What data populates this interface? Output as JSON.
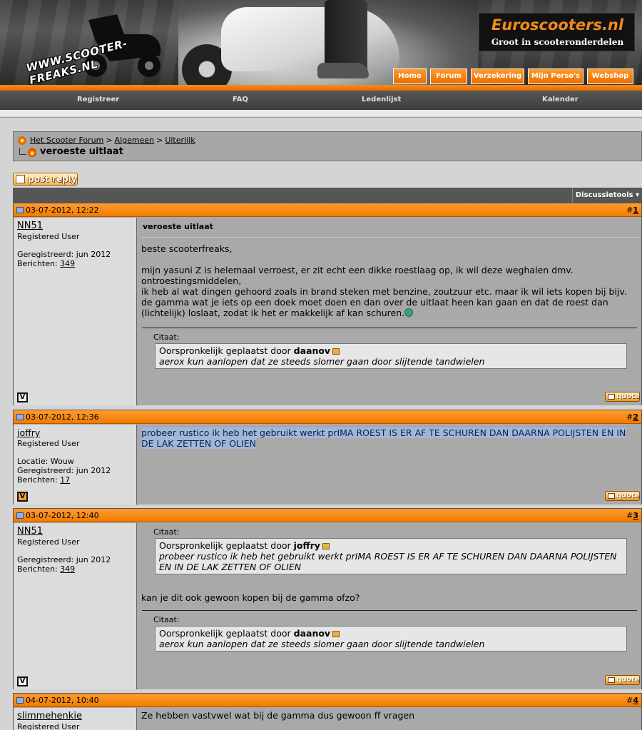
{
  "header": {
    "logo_text": "WWW.SCOOTER-FREAKS.NL",
    "sponsor_title": "Euroscooters.nl",
    "sponsor_subtitle": "Groot in scooteronderdelen",
    "nav": [
      "Home",
      "Forum",
      "Verzekering",
      "Mijn Perso's",
      "Webshop"
    ],
    "subnav": [
      "Registreer",
      "FAQ",
      "Ledenlijst",
      "Kalender"
    ]
  },
  "breadcrumb": {
    "items": [
      "Het Scooter Forum",
      "Algemeen",
      "Uiterlijk"
    ],
    "separator": ">",
    "title": "veroeste uitlaat"
  },
  "toolbar": {
    "post_reply_label": "post reply",
    "tools_label": "Discussietools"
  },
  "posts": [
    {
      "date": "03-07-2012, 12:22",
      "number": "1",
      "user": "NN51",
      "user_title": "Registered User",
      "registered": "Geregistreerd: jun 2012",
      "posts_label": "Berichten:",
      "posts_count": "349",
      "title": "veroeste uitlaat",
      "text": "beste scooterfreaks,\n\nmijn yasuni Z is helemaal verroest, er zit echt een dikke roestlaag op, ik wil deze weghalen dmv. ontroestingsmiddelen,\nik heb al wat dingen gehoord zoals in brand steken met benzine, zoutzuur etc. maar ik wil iets kopen bij bijv. de gamma wat je iets op een doek moet doen en dan over de uitlaat heen kan gaan en dat de roest dan (lichtelijk) loslaat, zodat ik het er makkelijk af kan schuren.",
      "quote_label": "Citaat:",
      "quote_by_prefix": "Oorspronkelijk geplaatst door",
      "quote_author": "daanov",
      "quote_text": "aerox kun aanlopen dat ze steeds slomer gaan door slijtende tandwielen",
      "quote_button": "quote"
    },
    {
      "date": "03-07-2012, 12:36",
      "number": "2",
      "user": "joffry",
      "user_title": "Registered User",
      "location": "Locatie: Wouw",
      "registered": "Geregistreerd: jun 2012",
      "posts_label": "Berichten:",
      "posts_count": "17",
      "text": "probeer rustico ik heb het gebruikt werkt prIMA ROEST IS ER AF TE SCHUREN DAN DAARNA POLIJSTEN EN IN DE LAK ZETTEN OF OLIEN",
      "quote_button": "quote"
    },
    {
      "date": "03-07-2012, 12:40",
      "number": "3",
      "user": "NN51",
      "user_title": "Registered User",
      "registered": "Geregistreerd: jun 2012",
      "posts_label": "Berichten:",
      "posts_count": "349",
      "quote1_label": "Citaat:",
      "quote1_by_prefix": "Oorspronkelijk geplaatst door",
      "quote1_author": "joffry",
      "quote1_text": "probeer rustico ik heb het gebruikt werkt prIMA ROEST IS ER AF TE SCHUREN DAN DAARNA POLIJSTEN EN IN DE LAK ZETTEN OF OLIEN",
      "text": "kan je dit ook gewoon kopen bij de gamma ofzo?",
      "quote2_label": "Citaat:",
      "quote2_by_prefix": "Oorspronkelijk geplaatst door",
      "quote2_author": "daanov",
      "quote2_text": "aerox kun aanlopen dat ze steeds slomer gaan door slijtende tandwielen",
      "quote_button": "quote"
    },
    {
      "date": "04-07-2012, 10:40",
      "number": "4",
      "user": "slimmehenkie",
      "user_title": "Registered User",
      "text": "Ze hebben vastvwel wat bij de gamma dus gewoon ff vragen"
    }
  ],
  "badge_letter": "V",
  "post_number_prefix": "#",
  "colors": {
    "accent": "#f07c00",
    "header_dark": "#3e3e3e",
    "content_bg": "#a9a9a9"
  }
}
